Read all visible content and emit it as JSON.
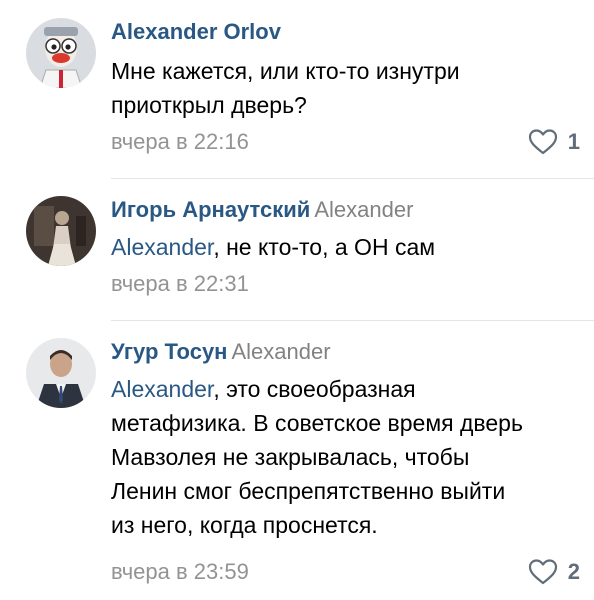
{
  "comments": [
    {
      "author": "Alexander Orlov",
      "reply_to": "",
      "mention": "",
      "lines": [
        "Мне кажется, или кто-то изнутри",
        "приоткрыл дверь?"
      ],
      "date": "вчера в 22:16",
      "likes": "1",
      "avatar_icon": "cartoon-character-avatar"
    },
    {
      "author": "Игорь Арнаутский",
      "reply_to": "Alexander",
      "mention": "Alexander",
      "lines": [
        ", не кто-то, а ОН сам"
      ],
      "date": "вчера в 22:31",
      "likes": "",
      "avatar_icon": "vintage-photo-avatar"
    },
    {
      "author": "Угур Тосун",
      "reply_to": "Alexander",
      "mention": "Alexander",
      "lines": [
        ", это своеобразная",
        "метафизика. В советское время дверь",
        "Мавзолея не закрывалась, чтобы",
        "Ленин смог беспрепятственно выйти",
        "из него, когда проснется."
      ],
      "date": "вчера в 23:59",
      "likes": "2",
      "avatar_icon": "man-in-suit-avatar"
    }
  ],
  "icons": {
    "like": "heart-outline-icon"
  },
  "colors": {
    "author": "#2a5885",
    "meta": "#939393",
    "like": "#626d7a",
    "divider": "#e3e6ea"
  }
}
